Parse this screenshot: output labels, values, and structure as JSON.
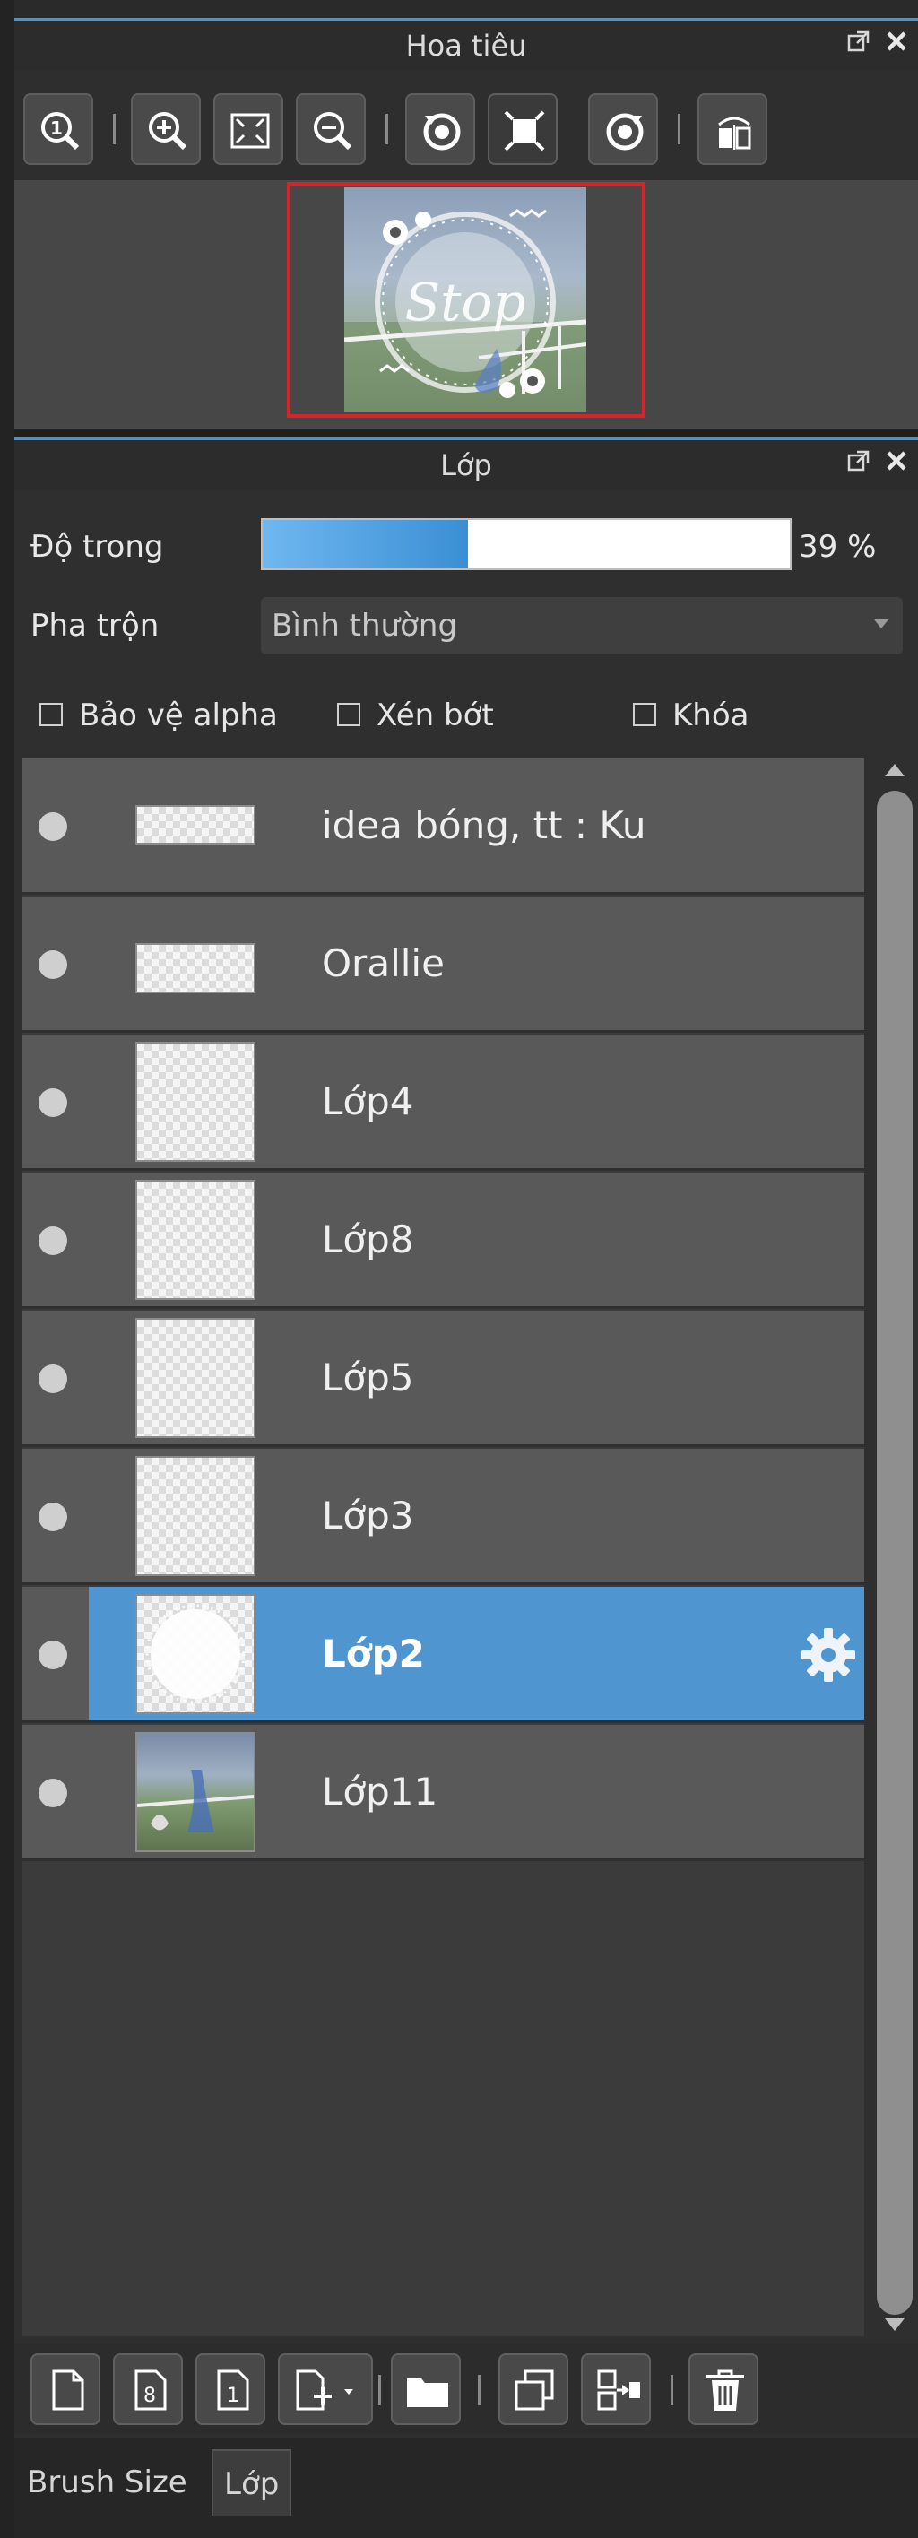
{
  "navigator": {
    "title": "Hoa tiêu",
    "toolbar_icons": [
      "zoom-actual-icon",
      "zoom-in-icon",
      "fit-screen-icon",
      "zoom-out-icon",
      "rotate-left-icon",
      "fit-window-icon",
      "rotate-right-icon",
      "flip-horizontal-icon"
    ],
    "preview_text": "Stop"
  },
  "layer_panel": {
    "title": "Lớp",
    "opacity_label": "Độ trong",
    "opacity_value": "39 %",
    "opacity_fraction": 0.39,
    "blend_label": "Pha trộn",
    "blend_value": "Bình thường",
    "checkboxes": {
      "alpha": "Bảo vệ alpha",
      "clip": "Xén bớt",
      "lock": "Khóa"
    },
    "layers": [
      {
        "name": "idea bóng, tt : Ku",
        "selected": false
      },
      {
        "name": "Orallie",
        "selected": false
      },
      {
        "name": "Lớp4",
        "selected": false
      },
      {
        "name": "Lớp8",
        "selected": false
      },
      {
        "name": "Lớp5",
        "selected": false
      },
      {
        "name": "Lớp3",
        "selected": false
      },
      {
        "name": "Lớp2",
        "selected": true
      },
      {
        "name": "Lớp11",
        "selected": false
      }
    ],
    "bottom_toolbar_icons": [
      "new-layer-icon",
      "new-8bit-layer-icon",
      "new-1bit-layer-icon",
      "add-layer-menu-icon",
      "folder-icon",
      "duplicate-layer-icon",
      "merge-layer-icon",
      "delete-layer-icon"
    ]
  },
  "tabs": {
    "brush_size": "Brush Size",
    "layer": "Lớp"
  },
  "colors": {
    "selection": "#4f96d1",
    "opacity_fill": "#3a8fd4",
    "preview_border": "#d9232a"
  }
}
